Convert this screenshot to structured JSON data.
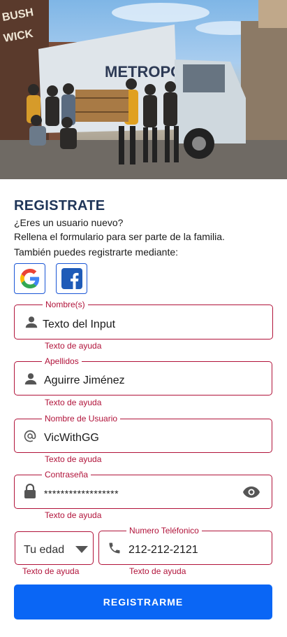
{
  "hero": {
    "truck_brand": "METROPOLIS",
    "wall_text": "BUSHWICK"
  },
  "header": {
    "title": "REGISTRATE",
    "line1": "¿Eres un usuario nuevo?",
    "line2": "Rellena el formulario para ser parte de la familia.",
    "line3": "También puedes registrarte mediante:"
  },
  "social": {
    "google_icon": "google-icon",
    "facebook_icon": "facebook-icon"
  },
  "form": {
    "nombre": {
      "label": "Nombre(s)",
      "value": "Texto del Input",
      "help": "Texto de ayuda"
    },
    "apellidos": {
      "label": "Apellidos",
      "value": "Aguirre Jiménez",
      "help": "Texto de ayuda"
    },
    "usuario": {
      "label": "Nombre de Usuario",
      "value": "VicWithGG",
      "help": "Texto de ayuda"
    },
    "contrasena": {
      "label": "Contraseña",
      "value": "******************",
      "help": "Texto de ayuda"
    },
    "edad": {
      "value": "Tu edad",
      "help": "Texto de ayuda"
    },
    "telefono": {
      "label": "Numero Teléfonico",
      "value": "212-212-2121",
      "help": "Texto de ayuda"
    }
  },
  "submit_label": "REGISTRARME",
  "colors": {
    "error": "#b1133a",
    "primary": "#0a66f5",
    "title": "#1f3558"
  }
}
